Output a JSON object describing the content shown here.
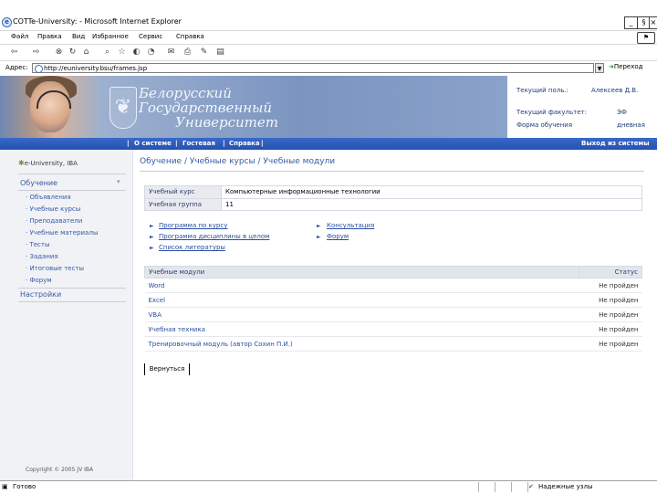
{
  "window": {
    "title": "COTTe-University: - Microsoft Internet Explorer",
    "controls": [
      "_",
      "§",
      "×"
    ]
  },
  "menu": [
    "Файл",
    "Правка",
    "Вид",
    "Избранное",
    "Сервис",
    "Справка"
  ],
  "address": {
    "label": "Адрес:",
    "url": "http://euniversity.bsu/frames.jsp",
    "go_label": "Переход"
  },
  "banner": {
    "line1": "Белорусский",
    "line2": "Государственный",
    "line3": "Университет",
    "crest_glyph": "❦",
    "user_label": "Текущий поль.:",
    "user_value": "Алексеев Д.В.",
    "faculty_label": "Текущий факультет:",
    "faculty_value": "ЭФ",
    "form_label": "Форма обучения",
    "form_value": "дневная"
  },
  "topnav": {
    "items": [
      "О системе",
      "Гостевая",
      "Справка"
    ],
    "separator": "|",
    "logout": "Выход из системы"
  },
  "sidebar": {
    "logo": "e-University, IBA",
    "section1": "Обучение",
    "items": [
      "Объявления",
      "Учебные курсы",
      "Преподаватели",
      "Учебные материалы",
      "Тесты",
      "Задания",
      "Итоговые тесты",
      "Форум"
    ],
    "section2": "Настройки",
    "copyright": "Copyright © 2005 JV IBA"
  },
  "main": {
    "breadcrumb": "Обучение / Учебные курсы / Учебные модули",
    "course_label": "Учебный курс",
    "course_value": "Компьютерные информационные технологии",
    "group_label": "Учебная группа",
    "group_value": "11",
    "links_left": [
      "Программа по курсу",
      "Программа дисциплины в целом",
      "Список литературы"
    ],
    "links_right": [
      "Консультация",
      "Форум"
    ],
    "modules_header": "Учебные модули",
    "status_header": "Статус",
    "modules": [
      {
        "name": "Word",
        "status": "Не пройден"
      },
      {
        "name": "Excel",
        "status": "Не пройден"
      },
      {
        "name": "VBA",
        "status": "Не пройден"
      },
      {
        "name": "Учебная техника",
        "status": "Не пройден"
      },
      {
        "name": "Тренировочный модуль (автор Сохин П.И.)",
        "status": "Не пройден"
      }
    ],
    "back_button": "Вернуться"
  },
  "statusbar": {
    "left": "Готово",
    "right": "Надежные узлы"
  }
}
